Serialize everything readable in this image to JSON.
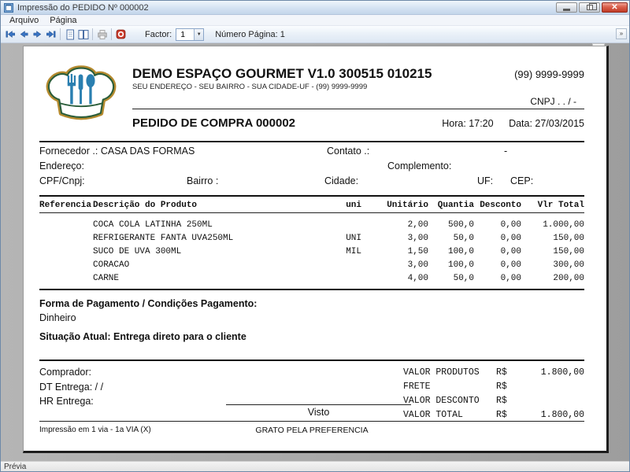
{
  "window": {
    "title": "Impressão do PEDIDO Nº 000002"
  },
  "menu": {
    "items": [
      "Arquivo",
      "Página"
    ]
  },
  "toolbar": {
    "factor_label": "Factor:",
    "factor_value": "1",
    "page_number_label": "Número Página: 1"
  },
  "statusbar": {
    "text": "Prévia"
  },
  "colors": {
    "nav_arrow_blue": "#3a75c4",
    "stop_red": "#cc3b2b",
    "logo_gold": "#b58a2e",
    "logo_green": "#2a5d3a",
    "logo_blue": "#2a7fb0"
  },
  "document": {
    "company": {
      "name": "DEMO ESPAÇO GOURMET V1.0 300515 010215",
      "address": "SEU ENDEREÇO - SEU BAIRRO - SUA CIDADE-UF - (99) 9999-9999",
      "phone": "(99) 9999-9999",
      "cnpj": "CNPJ .  . /  -"
    },
    "order": {
      "title": "PEDIDO DE COMPRA 000002",
      "hora": "Hora: 17:20",
      "data": "Data: 27/03/2015"
    },
    "supplier": {
      "fornecedor_label": "Fornecedor .:",
      "fornecedor_value": "CASA DAS FORMAS",
      "contato_label": "Contato .:",
      "contato_value": "-",
      "endereco_label": "Endereço:",
      "complemento_label": "Complemento:",
      "cpf_label": "CPF/Cnpj:",
      "bairro_label": "Bairro :",
      "cidade_label": "Cidade:",
      "uf_label": "UF:",
      "cep_label": "CEP:"
    },
    "items_table": {
      "headers": [
        "Referencia",
        "Descrição do Produto",
        "uni",
        "Unitário",
        "Quantia",
        "Desconto",
        "Vlr Total"
      ],
      "rows": [
        {
          "referencia": "",
          "descricao": "COCA COLA LATINHA 250ML",
          "uni": "",
          "unitario": "2,00",
          "quantia": "500,0",
          "desconto": "0,00",
          "vlr_total": "1.000,00"
        },
        {
          "referencia": "",
          "descricao": "REFRIGERANTE FANTA UVA250ML",
          "uni": "UNI",
          "unitario": "3,00",
          "quantia": "50,0",
          "desconto": "0,00",
          "vlr_total": "150,00"
        },
        {
          "referencia": "",
          "descricao": "SUCO DE UVA 300ML",
          "uni": "MIL",
          "unitario": "1,50",
          "quantia": "100,0",
          "desconto": "0,00",
          "vlr_total": "150,00"
        },
        {
          "referencia": "",
          "descricao": "CORACAO",
          "uni": "",
          "unitario": "3,00",
          "quantia": "100,0",
          "desconto": "0,00",
          "vlr_total": "300,00"
        },
        {
          "referencia": "",
          "descricao": "CARNE",
          "uni": "",
          "unitario": "4,00",
          "quantia": "50,0",
          "desconto": "0,00",
          "vlr_total": "200,00"
        }
      ]
    },
    "payment": {
      "label": "Forma de Pagamento / Condições Pagamento:",
      "value": "Dinheiro",
      "situacao": "Situação Atual: Entrega direto para o cliente"
    },
    "delivery": {
      "comprador_label": "Comprador:",
      "dt_label": "DT Entrega:  / /",
      "hr_label": "HR Entrega:",
      "visto_label": "Visto"
    },
    "totals": [
      {
        "label": "VALOR PRODUTOS",
        "currency": "R$",
        "value": "1.800,00"
      },
      {
        "label": "FRETE",
        "currency": "R$",
        "value": ""
      },
      {
        "label": "VALOR DESCONTO",
        "currency": "R$",
        "value": ""
      },
      {
        "label": "VALOR TOTAL",
        "currency": "R$",
        "value": "1.800,00"
      }
    ],
    "print_footer": {
      "left": "Impressão em 1 via  -  1a VIA (X)",
      "center": "GRATO PELA PREFERENCIA"
    }
  }
}
